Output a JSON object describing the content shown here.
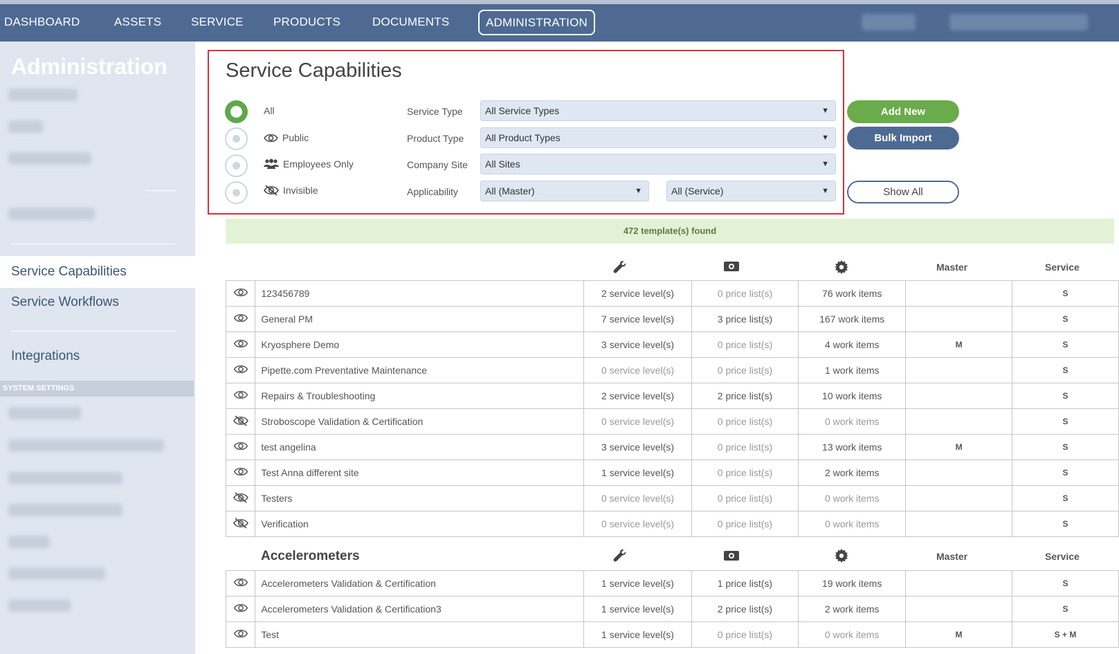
{
  "nav": {
    "items": [
      "DASHBOARD",
      "ASSETS",
      "SERVICE",
      "PRODUCTS",
      "DOCUMENTS"
    ],
    "active": "ADMINISTRATION"
  },
  "sidebar": {
    "title": "Administration",
    "links": [
      "Service Capabilities",
      "Service Workflows",
      "Integrations"
    ],
    "section_label": "SYSTEM SETTINGS"
  },
  "page": {
    "title": "Service Capabilities"
  },
  "filters": {
    "visibility": [
      "All",
      "Public",
      "Employees Only",
      "Invisible"
    ],
    "selected_visibility": "All",
    "labels": [
      "Service Type",
      "Product Type",
      "Company Site",
      "Applicability"
    ],
    "service_type": "All Service Types",
    "product_type": "All Product Types",
    "company_site": "All Sites",
    "applicability_master": "All (Master)",
    "applicability_service": "All (Service)"
  },
  "buttons": {
    "add_new": "Add New",
    "bulk_import": "Bulk Import",
    "show_all": "Show All"
  },
  "result_count": "472 template(s) found",
  "columns": {
    "master": "Master",
    "service": "Service"
  },
  "groups": [
    {
      "title": "",
      "rows": [
        {
          "vis": "public",
          "name": "123456789",
          "levels": "2 service level(s)",
          "prices": "0 price list(s)",
          "items": "76 work items",
          "master": "",
          "service": "S"
        },
        {
          "vis": "public",
          "name": "General PM",
          "levels": "7 service level(s)",
          "prices": "3 price list(s)",
          "items": "167 work items",
          "master": "",
          "service": "S"
        },
        {
          "vis": "public",
          "name": "Kryosphere Demo",
          "levels": "3 service level(s)",
          "prices": "0 price list(s)",
          "items": "4 work items",
          "master": "M",
          "service": "S"
        },
        {
          "vis": "public",
          "name": "Pipette.com Preventative Maintenance",
          "levels": "0 service level(s)",
          "prices": "0 price list(s)",
          "items": "1 work items",
          "master": "",
          "service": "S"
        },
        {
          "vis": "public",
          "name": "Repairs & Troubleshooting",
          "levels": "2 service level(s)",
          "prices": "2 price list(s)",
          "items": "10 work items",
          "master": "",
          "service": "S"
        },
        {
          "vis": "invisible",
          "name": "Stroboscope Validation & Certification",
          "levels": "0 service level(s)",
          "prices": "0 price list(s)",
          "items": "0 work items",
          "master": "",
          "service": "S"
        },
        {
          "vis": "public",
          "name": "test angelina",
          "levels": "3 service level(s)",
          "prices": "0 price list(s)",
          "items": "13 work items",
          "master": "M",
          "service": "S"
        },
        {
          "vis": "public",
          "name": "Test Anna different site",
          "levels": "1 service level(s)",
          "prices": "0 price list(s)",
          "items": "2 work items",
          "master": "",
          "service": "S"
        },
        {
          "vis": "invisible",
          "name": "Testers",
          "levels": "0 service level(s)",
          "prices": "0 price list(s)",
          "items": "0 work items",
          "master": "",
          "service": "S"
        },
        {
          "vis": "invisible",
          "name": "Verification",
          "levels": "0 service level(s)",
          "prices": "0 price list(s)",
          "items": "0 work items",
          "master": "",
          "service": "S"
        }
      ]
    },
    {
      "title": "Accelerometers",
      "rows": [
        {
          "vis": "public",
          "name": "Accelerometers Validation & Certification",
          "levels": "1 service level(s)",
          "prices": "1 price list(s)",
          "items": "19 work items",
          "master": "",
          "service": "S"
        },
        {
          "vis": "public",
          "name": "Accelerometers Validation & Certification3",
          "levels": "1 service level(s)",
          "prices": "2 price list(s)",
          "items": "2 work items",
          "master": "",
          "service": "S"
        },
        {
          "vis": "public",
          "name": "Test",
          "levels": "1 service level(s)",
          "prices": "0 price list(s)",
          "items": "0 work items",
          "master": "M",
          "service": "S + M"
        }
      ]
    }
  ],
  "colors": {
    "nav": "#4e6a93",
    "green": "#6aab4b",
    "highlight_border": "#d93038",
    "found_bg": "#e3f2d6"
  }
}
